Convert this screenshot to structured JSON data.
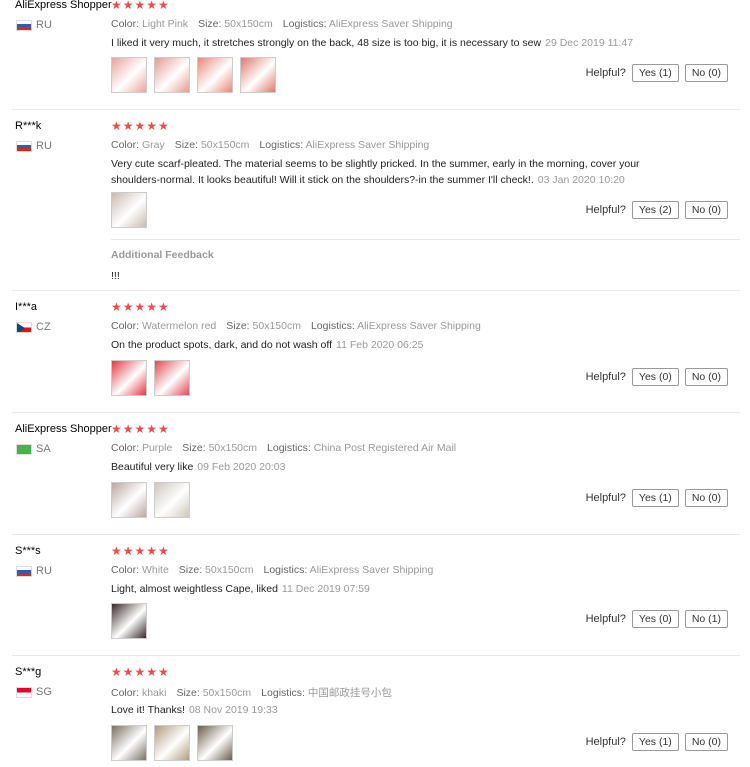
{
  "labels": {
    "color": "Color:",
    "size": "Size:",
    "logistics": "Logistics:",
    "helpful": "Helpful?",
    "additional_feedback": "Additional Feedback"
  },
  "reviews": [
    {
      "user": "AliExpress Shopper",
      "country": "RU",
      "stars": 5,
      "color": "Light Pink",
      "size": "50x150cm",
      "logistics": "AliExpress Saver Shipping",
      "text": "I liked it very much, it stretches strongly on the back, 48 size is too big, it is necessary to sew",
      "date": "29 Dec 2019 11:47",
      "yes": "Yes (1)",
      "no": "No (0)",
      "photos": [
        "#e8a59c",
        "#e39a95",
        "#e9877a",
        "#e0786b"
      ]
    },
    {
      "user": "R***k",
      "country": "RU",
      "stars": 5,
      "color": "Gray",
      "size": "50x150cm",
      "logistics": "AliExpress Saver Shipping",
      "text": "Very cute scarf-pleated. The material seems to be slightly pricked. In the summer, early in the morning, cover your shoulders-normal. It looks beautiful! Will it stick on the shoulders?-in the summer I'll check!.",
      "date": "03 Jan 2020 10:20",
      "yes": "Yes (2)",
      "no": "No (0)",
      "photos": [
        "#c9bcb0"
      ],
      "additional": "!!!"
    },
    {
      "user": "I***a",
      "country": "CZ",
      "stars": 5,
      "color": "Watermelon red",
      "size": "50x150cm",
      "logistics": "AliExpress Saver Shipping",
      "text": "On the product spots, dark, and do not wash off",
      "date": "11 Feb 2020 06:25",
      "yes": "Yes (0)",
      "no": "No (0)",
      "photos": [
        "#e03844",
        "#dd4a55"
      ]
    },
    {
      "user": "AliExpress Shopper",
      "country": "SA",
      "stars": 5,
      "color": "Purple",
      "size": "50x150cm",
      "logistics": "China Post Registered Air Mail",
      "text": "Beautiful very like",
      "date": "09 Feb 2020 20:03",
      "yes": "Yes (1)",
      "no": "No (0)",
      "photos": [
        "#b9a6a0",
        "#cfc6bd"
      ]
    },
    {
      "user": "S***s",
      "country": "RU",
      "stars": 5,
      "color": "White",
      "size": "50x150cm",
      "logistics": "AliExpress Saver Shipping",
      "text": "Light, almost weightless Cape, liked",
      "date": "11 Dec 2019 07:59",
      "yes": "Yes (0)",
      "no": "No (1)",
      "photos": [
        "#3a2a2a"
      ]
    },
    {
      "user": "S***g",
      "country": "SG",
      "stars": 5,
      "color": "khaki",
      "size": "50x150cm",
      "logistics": "中国邮政挂号小包",
      "text": "Love it! Thanks!",
      "date": "08 Nov 2019 19:33",
      "yes": "Yes (1)",
      "no": "No (0)",
      "photos": [
        "#7a6f63",
        "#b09c7e",
        "#6b5d4a"
      ]
    }
  ]
}
